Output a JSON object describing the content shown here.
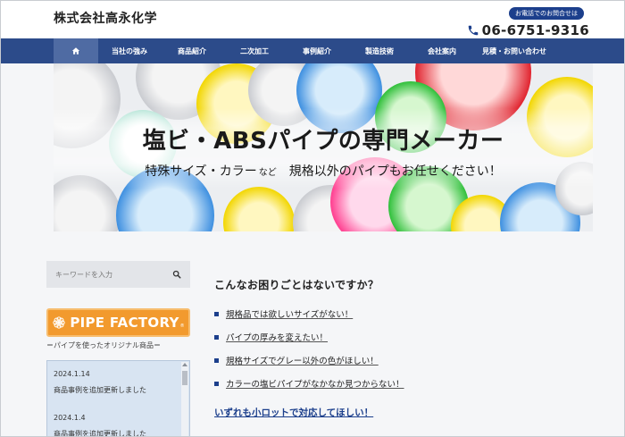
{
  "header": {
    "site_title": "株式会社高永化学",
    "contact_label": "お電話でのお問合せは",
    "phone": "06-6751-9316",
    "phone_icon": "phone-icon"
  },
  "nav": {
    "home_icon": "home-icon",
    "items": [
      {
        "label": "当社の強み"
      },
      {
        "label": "商品紹介"
      },
      {
        "label": "二次加工"
      },
      {
        "label": "事例紹介"
      },
      {
        "label": "製造技術"
      },
      {
        "label": "会社案内"
      },
      {
        "label": "見積・お問い合わせ"
      }
    ]
  },
  "hero": {
    "title": "塩ビ・ABSパイプの専門メーカー",
    "subtitle_main": "特殊サイズ・カラー",
    "subtitle_small": "など",
    "subtitle_rest": "規格以外のパイプもお任せください！"
  },
  "sidebar": {
    "search_placeholder": "キーワードを入力",
    "search_icon": "search-icon",
    "banner_text": "PIPE FACTORY",
    "banner_reg": "®",
    "banner_icon": "flower-icon",
    "banner_caption": "＝パイプを使ったオリジナル商品＝",
    "news": [
      {
        "date": "2024.1.14",
        "text": "商品事例を追加更新しました"
      },
      {
        "date": "2024.1.4",
        "text": "商品事例を追加更新しました"
      }
    ]
  },
  "main": {
    "heading": "こんなお困りごとはないですか？",
    "problems": [
      "規格品では欲しいサイズがない！",
      "パイプの厚みを変えたい！",
      "規格サイズでグレー以外の色がほしい！",
      "カラーの塩ビパイプがなかなか見つからない！"
    ],
    "conclusion": "いずれも小ロットで対応してほしい！"
  },
  "colors": {
    "nav_bg": "#2c4b8a",
    "accent": "#1c3f8c",
    "banner_orange": "#f29a2e"
  }
}
